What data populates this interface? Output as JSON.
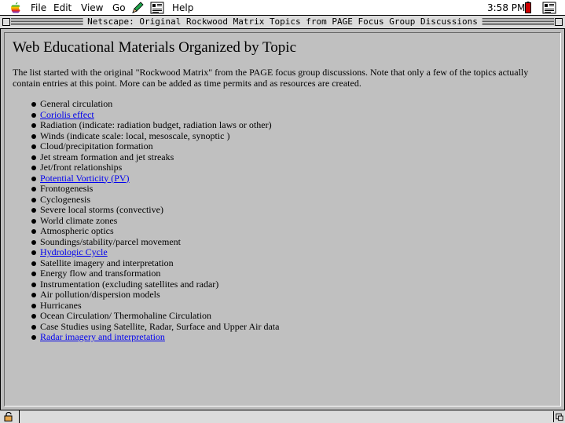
{
  "menubar": {
    "items": [
      "File",
      "Edit",
      "View",
      "Go",
      "Help"
    ],
    "clock": "3:58 PM"
  },
  "window": {
    "title": "Netscape: Original Rockwood Matrix Topics from PAGE Focus Group Discussions"
  },
  "page": {
    "heading": "Web Educational Materials Organized by Topic",
    "intro": "The list started with the original \"Rockwood Matrix\" from the PAGE focus group discussions.  Note that only a few of the topics actually contain entries at this point.  More can be added as time permits and as resources are created.",
    "topics": [
      {
        "label": "General circulation",
        "link": false
      },
      {
        "label": "Coriolis effect",
        "link": true
      },
      {
        "label": "Radiation (indicate: radiation budget, radiation laws or other)",
        "link": false
      },
      {
        "label": "Winds (indicate scale: local, mesoscale, synoptic )",
        "link": false
      },
      {
        "label": "Cloud/precipitation formation",
        "link": false
      },
      {
        "label": "Jet stream formation and jet streaks",
        "link": false
      },
      {
        "label": "Jet/front relationships",
        "link": false
      },
      {
        "label": "Potential Vorticity (PV)",
        "link": true
      },
      {
        "label": "Frontogenesis",
        "link": false
      },
      {
        "label": "Cyclogenesis",
        "link": false
      },
      {
        "label": "Severe local storms (convective)",
        "link": false
      },
      {
        "label": "World climate zones",
        "link": false
      },
      {
        "label": "Atmospheric optics",
        "link": false
      },
      {
        "label": "Soundings/stability/parcel movement",
        "link": false
      },
      {
        "label": "Hydrologic Cycle",
        "link": true
      },
      {
        "label": "Satellite imagery and interpretation",
        "link": false
      },
      {
        "label": "Energy flow and transformation",
        "link": false
      },
      {
        "label": "Instrumentation (excluding satellites and radar)",
        "link": false
      },
      {
        "label": "Air pollution/dispersion models",
        "link": false
      },
      {
        "label": "Hurricanes",
        "link": false
      },
      {
        "label": "Ocean Circulation/ Thermohaline Circulation",
        "link": false
      },
      {
        "label": "Case Studies using Satellite, Radar, Surface and Upper Air data",
        "link": false
      },
      {
        "label": "Radar imagery and interpretation",
        "link": true
      }
    ]
  },
  "colors": {
    "link": "#0000ee",
    "page_background": "#c0c0c0",
    "battery": "#cc0000"
  },
  "icons": [
    "apple-menu-icon",
    "edit-pencil-icon",
    "app-switcher-icon",
    "battery-icon",
    "security-lock-icon"
  ]
}
